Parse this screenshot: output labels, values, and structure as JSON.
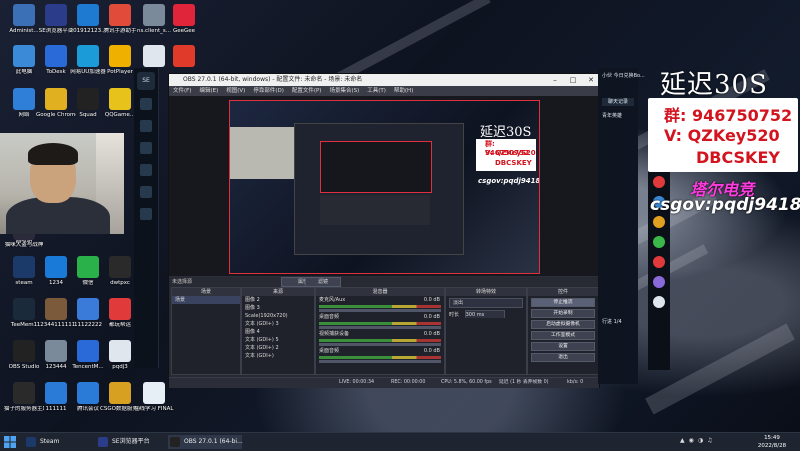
{
  "desktop_icons": [
    {
      "label": "Administ...",
      "color": "#3b6fb6"
    },
    {
      "label": "SE浏览器平台",
      "color": "#2a3c8a"
    },
    {
      "label": "201912123...",
      "color": "#1e7ad1"
    },
    {
      "label": "腾讯手游助手",
      "color": "#e04b3a"
    },
    {
      "label": "ns.client_s...",
      "color": "#7a8a9a"
    },
    {
      "label": "GeeGee",
      "color": "#e0243a"
    },
    {
      "label": "此电脑",
      "color": "#3a8ad8"
    },
    {
      "label": "ToDesk",
      "color": "#2a6ad8"
    },
    {
      "label": "网易UU加速器",
      "color": "#1b9bd8"
    },
    {
      "label": "PotPlayer",
      "color": "#f0b000"
    },
    {
      "label": "",
      "color": "#dfe6ee"
    },
    {
      "label": "",
      "color": "#e03a2a"
    },
    {
      "label": "网络",
      "color": "#2f7ed8"
    },
    {
      "label": "Google Chrome",
      "color": "#e0b020"
    },
    {
      "label": "Squad",
      "color": "#222222"
    },
    {
      "label": "QQGame...",
      "color": "#e6c21a"
    },
    {
      "label": "回收站",
      "color": "#8aa0b8"
    },
    {
      "label": "steam",
      "color": "#1b3a6a"
    },
    {
      "label": "1234",
      "color": "#1a7ad8"
    },
    {
      "label": "微信",
      "color": "#2ab14a"
    },
    {
      "label": "dwtpxc",
      "color": "#2a2a2a"
    },
    {
      "label": "TeeMem1",
      "color": "#1a2a3a"
    },
    {
      "label": "12344111111",
      "color": "#7a5a3a"
    },
    {
      "label": "11122222",
      "color": "#3a7ad8"
    },
    {
      "label": "都玩帮运",
      "color": "#e03a3a"
    },
    {
      "label": "OBS Studio",
      "color": "#222222"
    },
    {
      "label": "123444",
      "color": "#7a8a9a"
    },
    {
      "label": "TencentM...",
      "color": "#2a6ad8"
    },
    {
      "label": "pqdj3",
      "color": "#e0e6ee"
    },
    {
      "label": "猫子的服务器主题",
      "color": "#2a2a2a"
    },
    {
      "label": "111111",
      "color": "#2a7ad8"
    },
    {
      "label": "腾讯会议",
      "color": "#2a7ad8"
    },
    {
      "label": "CSGO数据服务对比",
      "color": "#d8a020"
    },
    {
      "label": "在线学习 FINAL BETA",
      "color": "#e6eef6"
    },
    {
      "label": "猫咪大盗与战神",
      "color": "#2a2a3a"
    }
  ],
  "obs": {
    "title": "OBS 27.0.1 (64-bit, windows) - 配置文件: 未命名 - 场景: 未命名",
    "menu": [
      "文件(F)",
      "编辑(E)",
      "视图(V)",
      "停靠部件(D)",
      "配置文件(P)",
      "场景集合(S)",
      "工具(T)",
      "帮助(H)"
    ],
    "not_source": "未选择源",
    "props_label": "属性",
    "filters_label": "滤镜",
    "docks": {
      "scenes_title": "场景",
      "scenes": [
        "场景"
      ],
      "sources_title": "来源",
      "sources": [
        "图像 2",
        "图像 3",
        "Scale(1920x720)",
        "文本 (GDI+) 3",
        "图像 4",
        "文本 (GDI+) 5",
        "文本 (GDI+) 2",
        "文本 (GDI+)"
      ],
      "mixer_title": "混音器",
      "mixer": [
        {
          "name": "麦克风/Aux",
          "db": "0.0 dB"
        },
        {
          "name": "桌面音频",
          "db": "0.0 dB"
        },
        {
          "name": "视频捕获设备",
          "db": "0.0 dB"
        },
        {
          "name": "桌面音频",
          "db": "0.0 dB"
        }
      ],
      "transitions_title": "转场特效",
      "transition": "淡出",
      "duration_label": "时长",
      "duration": "300 ms",
      "controls_title": "控件",
      "controls": [
        "停止推流",
        "开始录制",
        "启动虚拟摄像机",
        "工作室模式",
        "设置",
        "退出"
      ]
    },
    "status": {
      "live": "LIVE: 00:00:34",
      "rec": "REC: 00:00:00",
      "cpu": "CPU: 5.8%, 60.00 fps",
      "delay": "延迟 (1 秒 丢弃帧数 0)",
      "kbs": "kb/s: 0"
    }
  },
  "overlay": {
    "title": "延迟30S",
    "group": "群: 946750752",
    "v": "V: QZKey520",
    "dbc": "DBCSKEY",
    "brand": "塔尔电竞",
    "csgov": "csgov:pqdj9418"
  },
  "preview_overlay": {
    "title": "延迟30S",
    "group": "群: 946750752",
    "v": "V: QZKey520",
    "dbc": "DBCSKEY",
    "csgov": "csgov:pqdj9418"
  },
  "chat": {
    "rows": [
      "小伙 今日兑换Bo...",
      "聊天记录",
      "青年英雄"
    ],
    "bottom": [
      "行进 1/4",
      "区"
    ]
  },
  "taskbar": {
    "items": [
      {
        "label": "Steam",
        "color": "#1b3a6a"
      },
      {
        "label": "SE浏览器平台",
        "color": "#2a3c8a"
      },
      {
        "label": "OBS 27.0.1 (64-bi...",
        "color": "#222222"
      }
    ],
    "time": "15:49",
    "date": "2022/8/28"
  }
}
